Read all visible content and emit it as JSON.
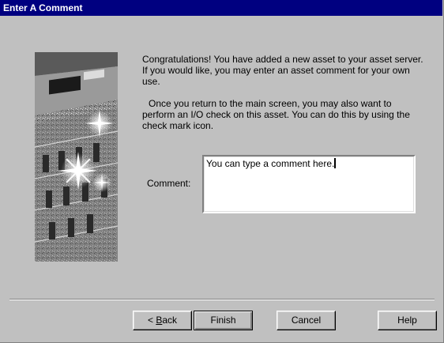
{
  "window": {
    "title": "Enter A Comment"
  },
  "message": {
    "paragraph1": "Congratulations!  You have added a new asset to your asset server.  If you would like, you may enter an asset comment for your own use.",
    "paragraph2": "Once you return to the main screen, you may also want to perform an I/O check on this asset.  You can do this by using the check mark icon."
  },
  "comment": {
    "label": "Comment:",
    "value": "You can type a comment here."
  },
  "buttons": {
    "back_prefix": "< ",
    "back_accel": "B",
    "back_rest": "ack",
    "finish": "Finish",
    "cancel": "Cancel",
    "help": "Help"
  },
  "colors": {
    "titlebar": "#000080",
    "face": "#c0c0c0"
  },
  "icons": {
    "wizard_image": "electronic-equipment-graphic"
  }
}
